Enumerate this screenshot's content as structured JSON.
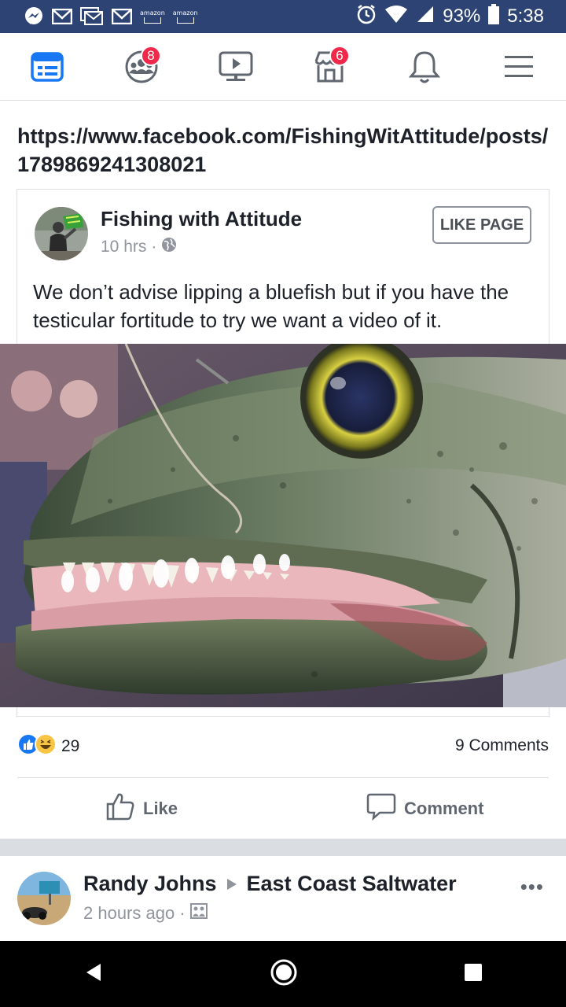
{
  "status_bar": {
    "amazon_1": "amazon",
    "amazon_2": "amazon",
    "battery": "93%",
    "time": "5:38"
  },
  "nav": {
    "groups_badge": "8",
    "marketplace_badge": "6"
  },
  "post": {
    "url": "https://www.facebook.com/FishingWitAttitude/posts/1789869241308021",
    "shared": {
      "page_name": "Fishing with Attitude",
      "time": "10 hrs",
      "like_page_label": "LIKE PAGE",
      "text": "We don’t advise lipping a bluefish but if you have the testicular fortitude to try we want a video of it."
    },
    "reactions_count": "29",
    "comments_count": "9 Comments",
    "like_label": "Like",
    "comment_label": "Comment"
  },
  "next_post": {
    "author": "Randy Johns",
    "group": "East Coast Saltwater",
    "time": "2 hours ago"
  },
  "colors": {
    "status_bar": "#2d4373",
    "facebook_blue": "#1877f2",
    "badge_red": "#f02849",
    "text": "#1d2129",
    "secondary_text": "#90949c"
  }
}
